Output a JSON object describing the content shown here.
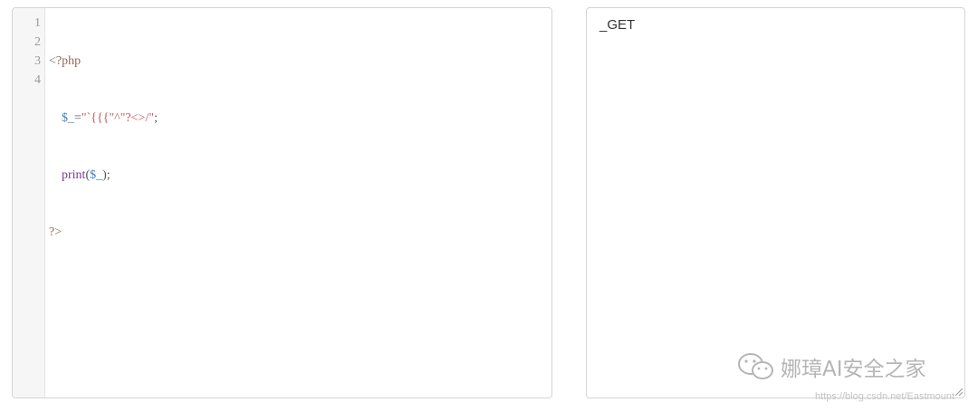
{
  "editor": {
    "line_numbers": [
      "1",
      "2",
      "3",
      "4"
    ],
    "lines": {
      "l1_open": "<?php",
      "l2_indent": "    ",
      "l2_var": "$_",
      "l2_eq": "=",
      "l2_str": "\"`{{{\"^\"?<>/\"",
      "l2_semi": ";",
      "l3_indent": "    ",
      "l3_print": "print",
      "l3_paren_open": "(",
      "l3_var": "$_",
      "l3_paren_close": ")",
      "l3_semi": ";",
      "l4_close": "?>"
    }
  },
  "output": {
    "text": "_GET"
  },
  "watermark": {
    "text": "娜璋AI安全之家",
    "icon": "wechat-icon",
    "url": "https://blog.csdn.net/Eastmount"
  }
}
